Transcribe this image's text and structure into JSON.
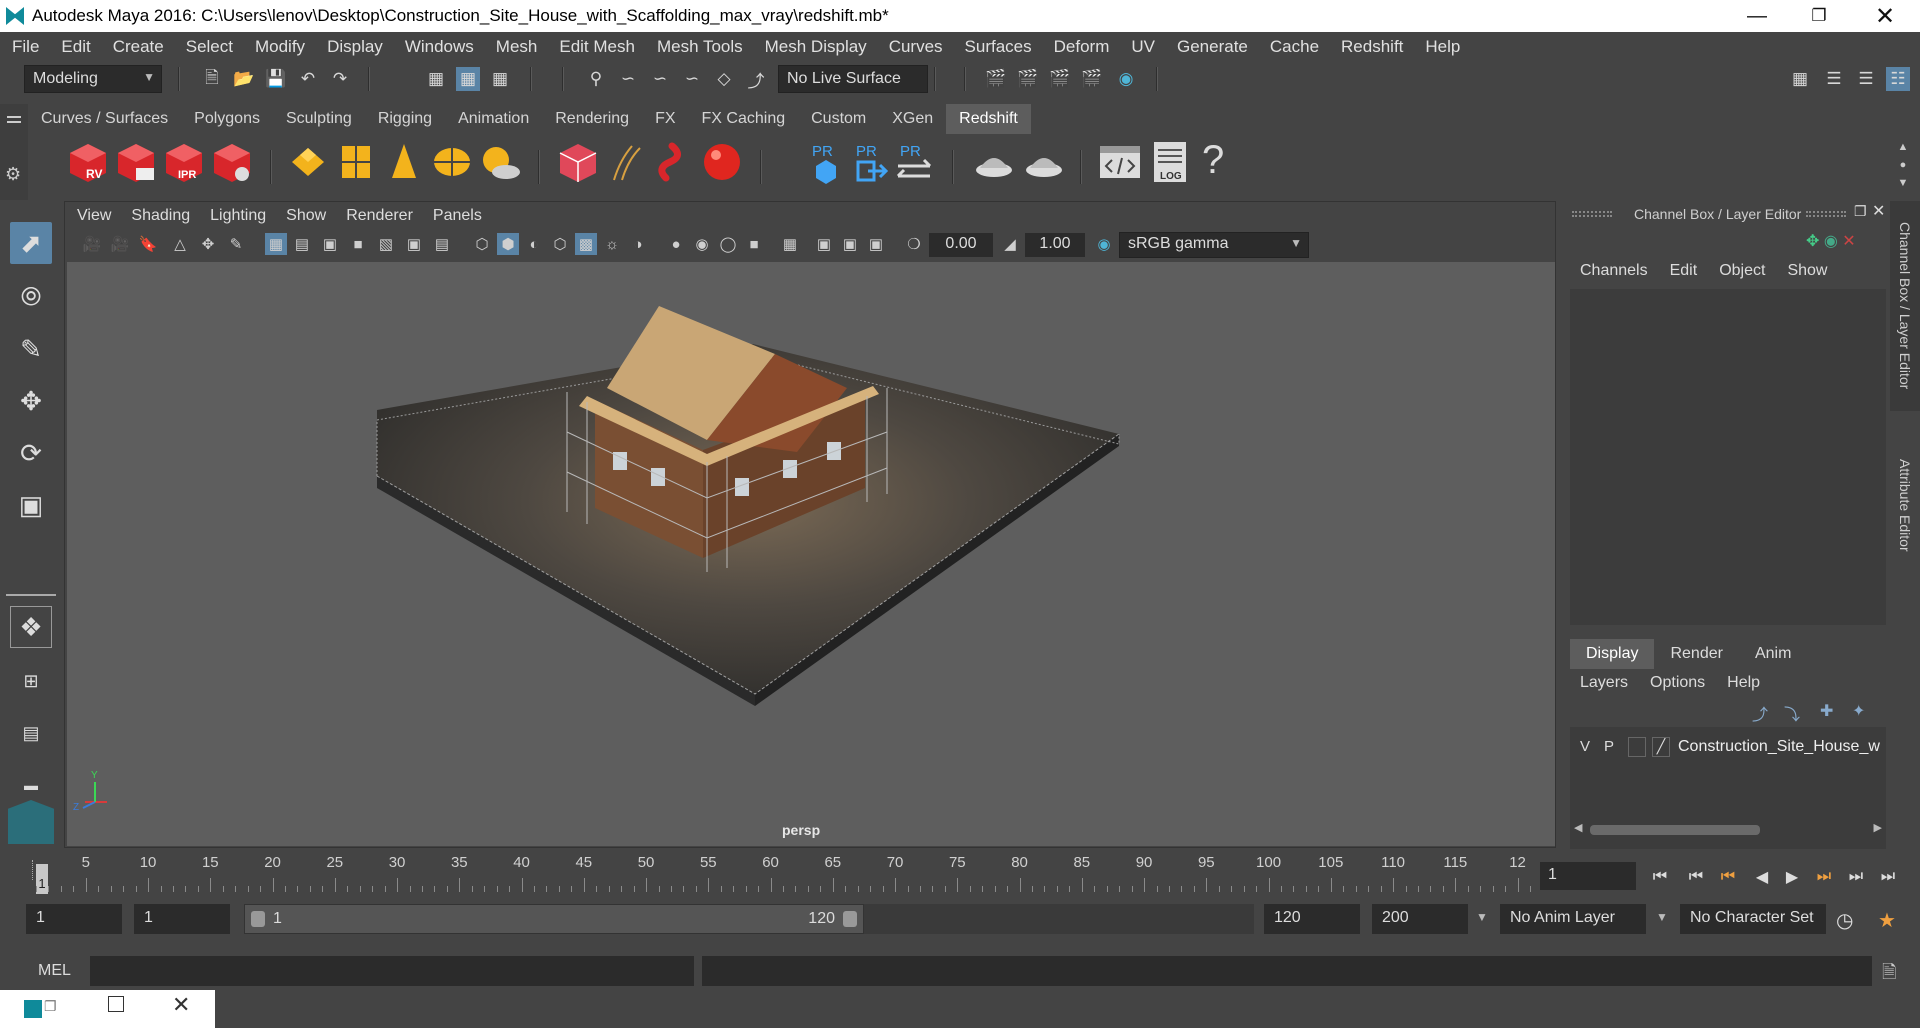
{
  "window": {
    "title": "Autodesk Maya 2016: C:\\Users\\lenov\\Desktop\\Construction_Site_House_with_Scaffolding_max_vray\\redshift.mb*"
  },
  "menubar": [
    "File",
    "Edit",
    "Create",
    "Select",
    "Modify",
    "Display",
    "Windows",
    "Mesh",
    "Edit Mesh",
    "Mesh Tools",
    "Mesh Display",
    "Curves",
    "Surfaces",
    "Deform",
    "UV",
    "Generate",
    "Cache",
    "Redshift",
    "Help"
  ],
  "statusline": {
    "mode": "Modeling",
    "live_surface": "No Live Surface"
  },
  "shelf": {
    "tabs": [
      "Curves / Surfaces",
      "Polygons",
      "Sculpting",
      "Rigging",
      "Animation",
      "Rendering",
      "FX",
      "FX Caching",
      "Custom",
      "XGen",
      "Redshift"
    ],
    "active_tab": "Redshift",
    "icon_labels": {
      "rv": "RV",
      "ipr": "IPR",
      "pr1": "PR",
      "pr2": "PR",
      "pr3": "PR",
      "log": "LOG"
    }
  },
  "viewport": {
    "menu": [
      "View",
      "Shading",
      "Lighting",
      "Show",
      "Renderer",
      "Panels"
    ],
    "exposure": "0.00",
    "gamma": "1.00",
    "colorspace": "sRGB gamma",
    "camera_label": "persp",
    "axis_y": "Y",
    "axis_z": "Z"
  },
  "channel_box": {
    "title": "Channel Box / Layer Editor",
    "menu": [
      "Channels",
      "Edit",
      "Object",
      "Show"
    ],
    "layer_tabs": [
      "Display",
      "Render",
      "Anim"
    ],
    "active_layer_tab": "Display",
    "layer_menu": [
      "Layers",
      "Options",
      "Help"
    ],
    "layer": {
      "v": "V",
      "p": "P",
      "name": "Construction_Site_House_w"
    }
  },
  "side_tabs": {
    "channel_box": "Channel Box / Layer Editor",
    "attribute_editor": "Attribute Editor"
  },
  "timeline": {
    "ticks": [
      "5",
      "10",
      "15",
      "20",
      "25",
      "30",
      "35",
      "40",
      "45",
      "50",
      "55",
      "60",
      "65",
      "70",
      "75",
      "80",
      "85",
      "90",
      "95",
      "100",
      "105",
      "110",
      "115",
      "12"
    ],
    "current_frame_marker": "1",
    "current_frame": "1"
  },
  "range": {
    "start": "1",
    "playback_start": "1",
    "slider_start": "1",
    "slider_end": "120",
    "playback_end": "120",
    "end": "200",
    "anim_layer": "No Anim Layer",
    "character_set": "No Character Set"
  },
  "cmdline": {
    "label": "MEL"
  }
}
